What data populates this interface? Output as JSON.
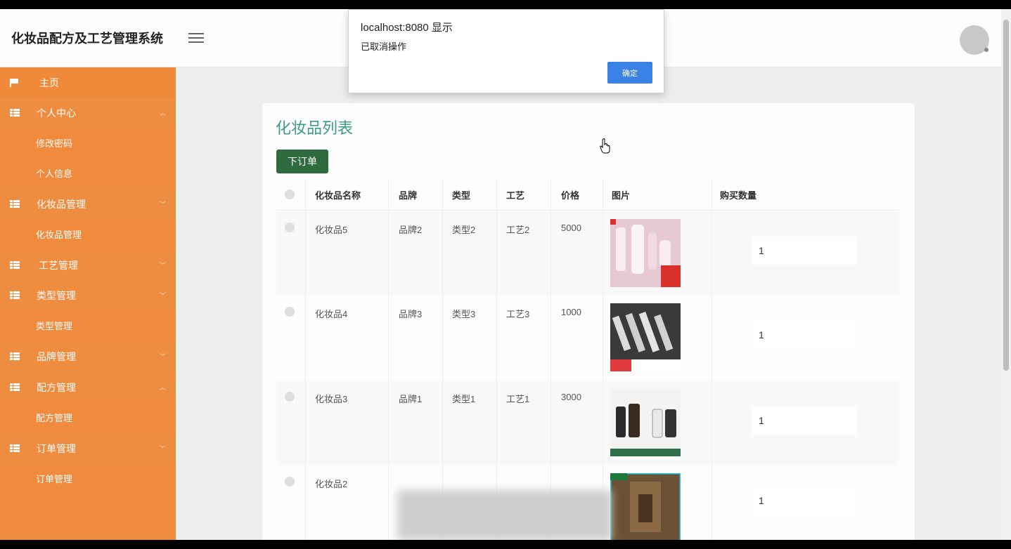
{
  "header": {
    "app_title": "化妆品配方及工艺管理系统"
  },
  "sidebar": {
    "items": [
      {
        "label": "主页",
        "type": "home"
      },
      {
        "label": "个人中心",
        "type": "group",
        "chevron": "^"
      },
      {
        "label": "修改密码",
        "type": "sub"
      },
      {
        "label": "个人信息",
        "type": "sub"
      },
      {
        "label": "化妆品管理",
        "type": "group",
        "chevron": "v"
      },
      {
        "label": "化妆品管理",
        "type": "sub"
      },
      {
        "label": "工艺管理",
        "type": "group",
        "chevron": "v"
      },
      {
        "label": "类型管理",
        "type": "group",
        "chevron": "v"
      },
      {
        "label": "类型管理",
        "type": "sub"
      },
      {
        "label": "品牌管理",
        "type": "group",
        "chevron": "v"
      },
      {
        "label": "配方管理",
        "type": "group",
        "chevron": "^"
      },
      {
        "label": "配方管理",
        "type": "sub"
      },
      {
        "label": "订单管理",
        "type": "group",
        "chevron": "v"
      },
      {
        "label": "订单管理",
        "type": "sub"
      }
    ]
  },
  "main": {
    "title": "化妆品列表",
    "order_button": "下订单",
    "columns": [
      "化妆品名称",
      "品牌",
      "类型",
      "工艺",
      "价格",
      "图片",
      "购买数量"
    ],
    "rows": [
      {
        "name": "化妆品5",
        "brand": "品牌2",
        "type": "类型2",
        "craft": "工艺2",
        "price": "5000",
        "qty": "1",
        "image": "pink-bottles-image"
      },
      {
        "name": "化妆品4",
        "brand": "品牌3",
        "type": "类型3",
        "craft": "工艺3",
        "price": "1000",
        "qty": "1",
        "image": "dark-tubes-image"
      },
      {
        "name": "化妆品3",
        "brand": "品牌1",
        "type": "类型1",
        "craft": "工艺1",
        "price": "3000",
        "qty": "1",
        "image": "skincare-set-image"
      },
      {
        "name": "化妆品2",
        "brand": "",
        "type": "",
        "craft": "",
        "price": "",
        "qty": "1",
        "image": "store-shelf-image"
      }
    ]
  },
  "dialog": {
    "title": "localhost:8080 显示",
    "message": "已取消操作",
    "ok_label": "确定"
  },
  "colors": {
    "sidebar": "#f08a3d",
    "title_accent": "#3c9a8a",
    "order_button": "#2e6b3f",
    "dialog_button": "#3b82e6"
  }
}
